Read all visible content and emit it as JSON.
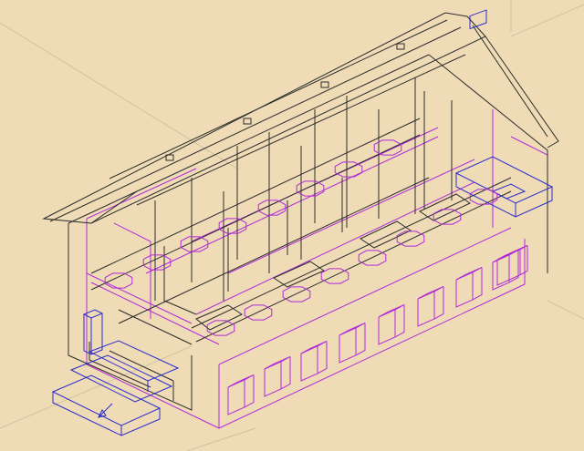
{
  "viewport": {
    "background": "#efdcb7",
    "line_colors": {
      "structure": "#2b2b2b",
      "fixtures": "#b02ad8",
      "furniture": "#2a2acc",
      "guides": "#d6c6a4"
    },
    "content": "isometric-wireframe-building"
  }
}
